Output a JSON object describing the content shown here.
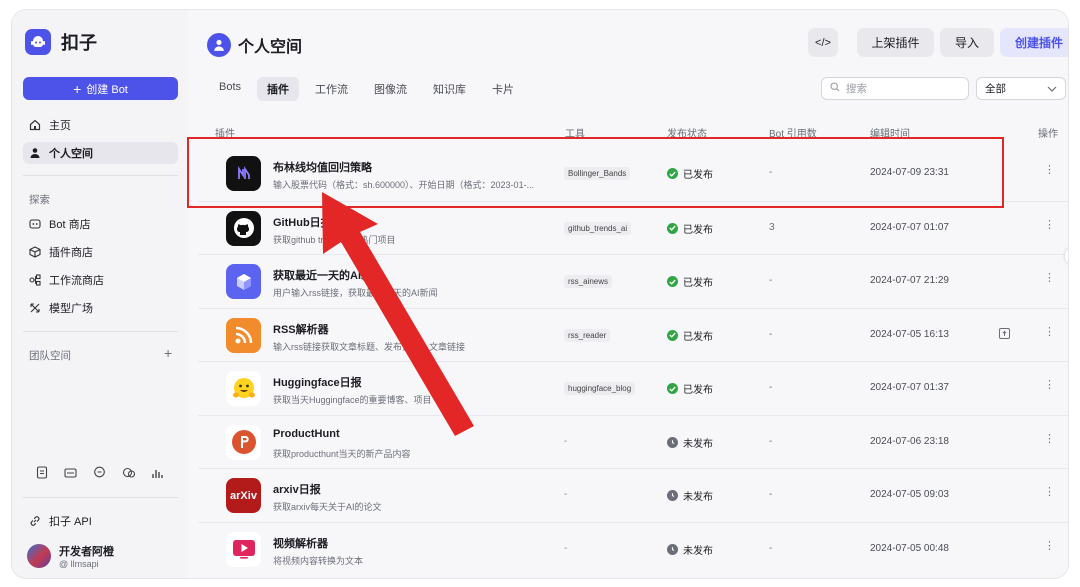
{
  "app": {
    "name": "扣子"
  },
  "sidebar": {
    "create_label": "创建 Bot",
    "items": [
      {
        "label": "主页"
      },
      {
        "label": "个人空间"
      }
    ],
    "explore_title": "探索",
    "explore_items": [
      {
        "label": "Bot 商店"
      },
      {
        "label": "插件商店"
      },
      {
        "label": "工作流商店"
      },
      {
        "label": "模型广场"
      }
    ],
    "team_title": "团队空间",
    "api_label": "扣子 API",
    "user": {
      "name": "开发者阿橙",
      "handle": "@ llmsapi"
    }
  },
  "header": {
    "title": "个人空间",
    "code_button": "</>",
    "publish_button": "上架插件",
    "import_button": "导入",
    "create_button": "创建插件"
  },
  "tabs": [
    {
      "label": "Bots"
    },
    {
      "label": "插件",
      "active": true
    },
    {
      "label": "工作流"
    },
    {
      "label": "图像流"
    },
    {
      "label": "知识库"
    },
    {
      "label": "卡片"
    }
  ],
  "search": {
    "placeholder": "搜索"
  },
  "filter": {
    "value": "全部"
  },
  "table": {
    "columns": [
      "插件",
      "工具",
      "发布状态",
      "Bot 引用数",
      "编辑时间",
      "操作"
    ],
    "rows": [
      {
        "name": "布林线均值回归策略",
        "desc": "输入股票代码（格式：sh.600000）、开始日期（格式：2023-01-...",
        "tool": "Bollinger_Bands",
        "status": "已发布",
        "published": true,
        "bots": "-",
        "time": "2024-07-09 23:31",
        "icon": "bollinger-icon"
      },
      {
        "name": "GitHub日报",
        "desc": "获取github trending的热门项目",
        "tool": "github_trends_ai",
        "status": "已发布",
        "published": true,
        "bots": "3",
        "time": "2024-07-07 01:07",
        "icon": "github-icon"
      },
      {
        "name": "获取最近一天的AI新闻",
        "desc": "用户输入rss链接，获取最近一天的AI新闻",
        "tool": "rss_ainews",
        "status": "已发布",
        "published": true,
        "bots": "-",
        "time": "2024-07-07 21:29",
        "icon": "cube-icon"
      },
      {
        "name": "RSS解析器",
        "desc": "输入rss链接获取文章标题、发布日期、文章链接",
        "tool": "rss_reader",
        "status": "已发布",
        "published": true,
        "bots": "-",
        "time": "2024-07-05 16:13",
        "icon": "rss-icon"
      },
      {
        "name": "Huggingface日报",
        "desc": "获取当天Huggingface的重要博客、项目",
        "tool": "huggingface_blog",
        "status": "已发布",
        "published": true,
        "bots": "-",
        "time": "2024-07-07 01:37",
        "icon": "huggingface-icon"
      },
      {
        "name": "ProductHunt",
        "desc": "获取producthunt当天的新产品内容",
        "tool": "-",
        "status": "未发布",
        "published": false,
        "bots": "-",
        "time": "2024-07-06 23:18",
        "icon": "producthunt-icon"
      },
      {
        "name": "arxiv日报",
        "desc": "获取arxiv每天关于AI的论文",
        "tool": "-",
        "status": "未发布",
        "published": false,
        "bots": "-",
        "time": "2024-07-05 09:03",
        "icon": "arxiv-icon"
      },
      {
        "name": "视频解析器",
        "desc": "将视频内容转换为文本",
        "tool": "-",
        "status": "未发布",
        "published": false,
        "bots": "-",
        "time": "2024-07-05 00:48",
        "icon": "video-icon"
      }
    ],
    "more_label": "⋮",
    "arxiv_text": "arXiv"
  },
  "annotation": {
    "color": "#e32626"
  },
  "colors": {
    "accent": "#4d53e8",
    "published": "#32a645"
  }
}
